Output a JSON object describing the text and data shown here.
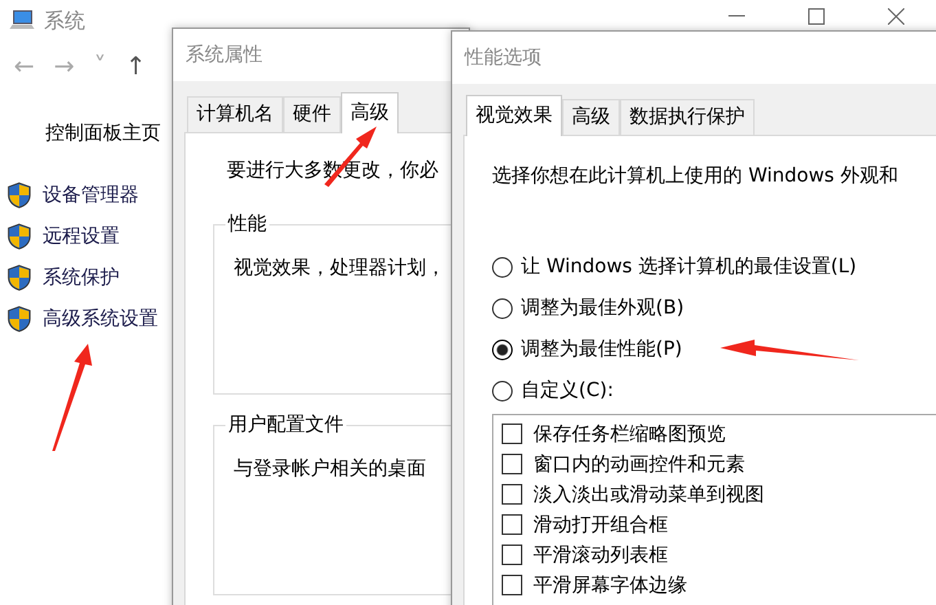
{
  "main_window": {
    "title": "系统",
    "nav": {
      "back": "←",
      "forward": "→",
      "recent": "˅",
      "up": "↑"
    },
    "home_link": "控制面板主页",
    "sidebar": {
      "items": [
        {
          "label": "设备管理器"
        },
        {
          "label": "远程设置"
        },
        {
          "label": "系统保护"
        },
        {
          "label": "高级系统设置"
        }
      ]
    }
  },
  "system_properties": {
    "title": "系统属性",
    "tabs": [
      {
        "label": "计算机名",
        "selected": false
      },
      {
        "label": "硬件",
        "selected": false
      },
      {
        "label": "高级",
        "selected": true
      }
    ],
    "intro": "要进行大多数更改，你必",
    "groups": [
      {
        "title": "性能",
        "text": "视觉效果，处理器计划，"
      },
      {
        "title": "用户配置文件",
        "text": "与登录帐户相关的桌面"
      }
    ]
  },
  "performance_options": {
    "title": "性能选项",
    "tabs": [
      {
        "label": "视觉效果",
        "selected": true
      },
      {
        "label": "高级",
        "selected": false
      },
      {
        "label": "数据执行保护",
        "selected": false
      }
    ],
    "description": "选择你想在此计算机上使用的 Windows 外观和",
    "options": [
      {
        "label": "让 Windows 选择计算机的最佳设置(L)",
        "selected": false
      },
      {
        "label": "调整为最佳外观(B)",
        "selected": false
      },
      {
        "label": "调整为最佳性能(P)",
        "selected": true
      },
      {
        "label": "自定义(C):",
        "selected": false
      }
    ],
    "effects": [
      {
        "label": "保存任务栏缩略图预览",
        "checked": false
      },
      {
        "label": "窗口内的动画控件和元素",
        "checked": false
      },
      {
        "label": "淡入淡出或滑动菜单到视图",
        "checked": false
      },
      {
        "label": "滑动打开组合框",
        "checked": false
      },
      {
        "label": "平滑滚动列表框",
        "checked": false
      },
      {
        "label": "平滑屏幕字体边缘",
        "checked": false
      }
    ]
  }
}
